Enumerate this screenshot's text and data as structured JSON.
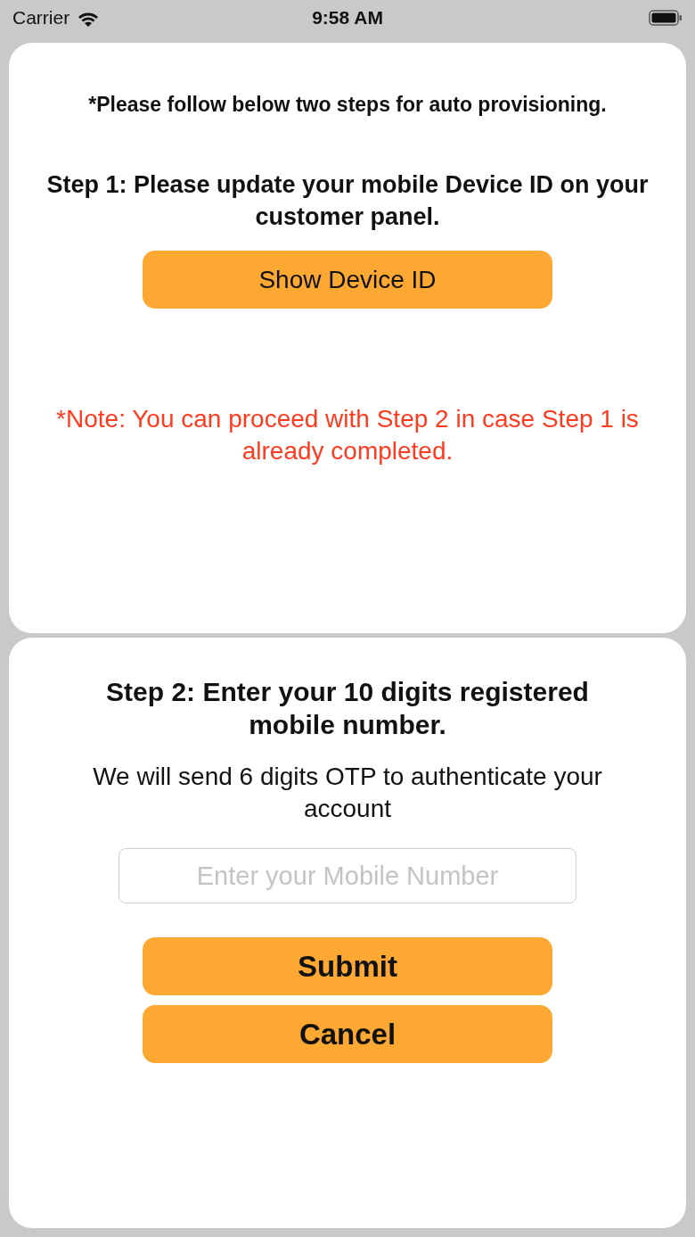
{
  "status_bar": {
    "carrier": "Carrier",
    "time": "9:58 AM"
  },
  "step1_card": {
    "intro": "*Please follow below two steps for auto provisioning.",
    "heading": "Step 1: Please update your mobile Device ID on your customer panel.",
    "button": "Show Device ID",
    "note": "*Note: You can proceed with Step 2 in case Step 1 is already completed."
  },
  "step2_card": {
    "heading": "Step 2: Enter your 10 digits registered mobile number.",
    "description": "We will send 6 digits OTP to authenticate your account",
    "mobile_field": {
      "placeholder": "Enter your Mobile Number"
    },
    "buttons": [
      "Submit",
      "Cancel"
    ]
  }
}
